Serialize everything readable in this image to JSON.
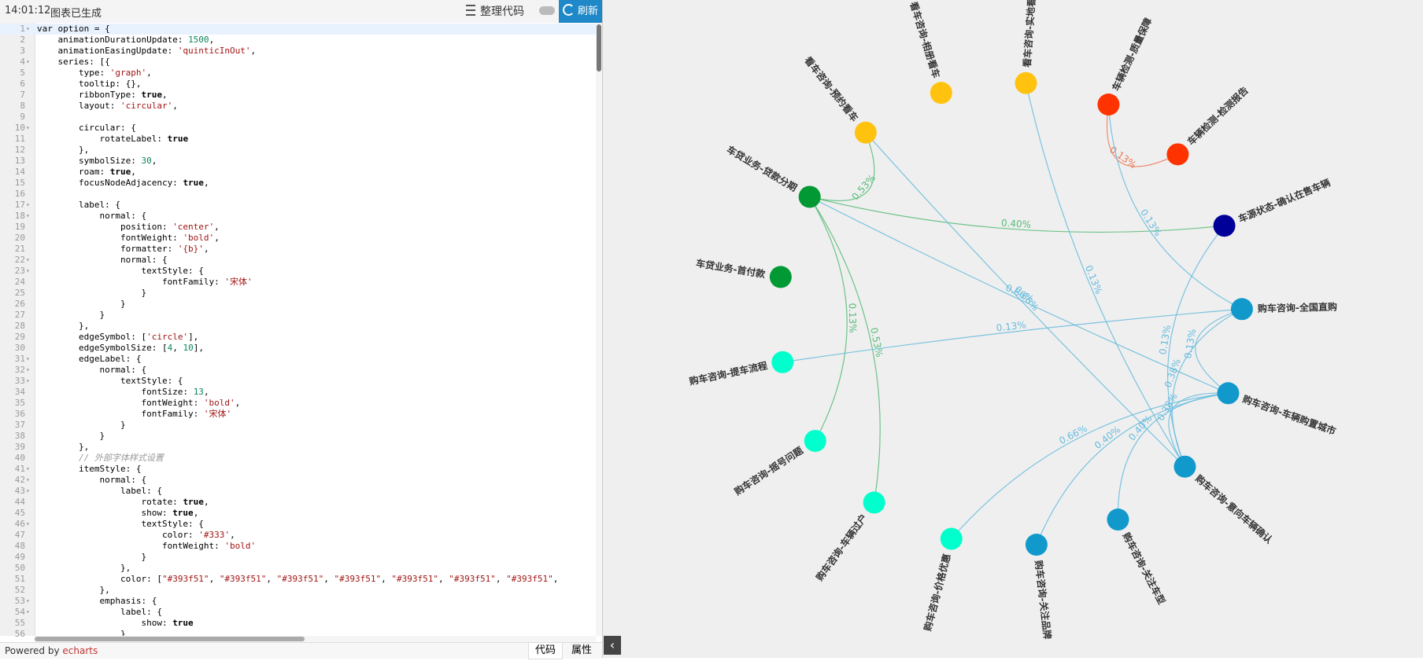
{
  "toolbar": {
    "time": "14:01:12",
    "status": "图表已生成",
    "format_label": "整理代码",
    "refresh_label": "刷新"
  },
  "footer": {
    "powered_prefix": "Powered by ",
    "powered_link": "echarts",
    "tab_code": "代码",
    "tab_props": "属性"
  },
  "code_lines": [
    "var option = {",
    "    animationDurationUpdate: 1500,",
    "    animationEasingUpdate: 'quinticInOut',",
    "    series: [{",
    "        type: 'graph',",
    "        tooltip: {},",
    "        ribbonType: true,",
    "        layout: 'circular',",
    "",
    "        circular: {",
    "            rotateLabel: true",
    "        },",
    "        symbolSize: 30,",
    "        roam: true,",
    "        focusNodeAdjacency: true,",
    "",
    "        label: {",
    "            normal: {",
    "                position: 'center',",
    "                fontWeight: 'bold',",
    "                formatter: '{b}',",
    "                normal: {",
    "                    textStyle: {",
    "                        fontFamily: '宋体'",
    "                    }",
    "                }",
    "            }",
    "        },",
    "        edgeSymbol: ['circle'],",
    "        edgeSymbolSize: [4, 10],",
    "        edgeLabel: {",
    "            normal: {",
    "                textStyle: {",
    "                    fontSize: 13,",
    "                    fontWeight: 'bold',",
    "                    fontFamily: '宋体'",
    "                }",
    "            }",
    "        },",
    "        // 外部字体样式设置",
    "        itemStyle: {",
    "            normal: {",
    "                label: {",
    "                    rotate: true,",
    "                    show: true,",
    "                    textStyle: {",
    "                        color: '#333',",
    "                        fontWeight: 'bold'",
    "                    }",
    "                },",
    "                color: [\"#393f51\", \"#393f51\", \"#393f51\", \"#393f51\", \"#393f51\", \"#393f51\", \"#393f51\", ",
    "            },",
    "            emphasis: {",
    "                label: {",
    "                    show: true",
    "                }"
  ],
  "fold_lines": [
    1,
    4,
    10,
    17,
    18,
    22,
    23,
    31,
    32,
    33,
    41,
    42,
    43,
    46,
    53,
    54
  ],
  "graph": {
    "nodes": [
      {
        "name": "看车咨询-相册看车",
        "color": "#ffc20e"
      },
      {
        "name": "看车咨询-实地看车",
        "color": "#ffc20e"
      },
      {
        "name": "车辆检测-质量保障",
        "color": "#ff3300"
      },
      {
        "name": "车辆检测-检测报告",
        "color": "#ff3300"
      },
      {
        "name": "车源状态-确认在售车辆",
        "color": "#000099"
      },
      {
        "name": "购车咨询-全国直购",
        "color": "#1199cc"
      },
      {
        "name": "购车咨询-车辆购置城市",
        "color": "#1199cc"
      },
      {
        "name": "购车咨询-意向车辆确认",
        "color": "#1199cc"
      },
      {
        "name": "购车咨询-关注车型",
        "color": "#1199cc"
      },
      {
        "name": "购车咨询-关注品牌",
        "color": "#1199cc"
      },
      {
        "name": "购车咨询-价格优惠",
        "color": "#00ffcc"
      },
      {
        "name": "购车咨询-车辆过户",
        "color": "#00ffcc"
      },
      {
        "name": "购车咨询-摇号问题",
        "color": "#00ffcc"
      },
      {
        "name": "购车咨询-提车流程",
        "color": "#00ffcc"
      },
      {
        "name": "车贷业务-首付款",
        "color": "#009933"
      },
      {
        "name": "车贷业务-贷款分期",
        "color": "#009933"
      },
      {
        "name": "看车咨询-预约看车",
        "color": "#ffc20e"
      }
    ],
    "edges": [
      {
        "source": 2,
        "target": 3,
        "label": "0.13%",
        "color": "#ee7755"
      },
      {
        "source": 16,
        "target": 15,
        "label": "0.53%",
        "color": "#55bb77"
      },
      {
        "source": 15,
        "target": 4,
        "label": "0.40%",
        "color": "#55bb77"
      },
      {
        "source": 15,
        "target": 12,
        "label": "0.13%",
        "color": "#55bb77"
      },
      {
        "source": 15,
        "target": 11,
        "label": "0.53%",
        "color": "#55bb77"
      },
      {
        "source": 15,
        "target": 6,
        "label": "0.66%",
        "color": "#66bbdd"
      },
      {
        "source": 16,
        "target": 7,
        "label": "0.66%",
        "color": "#66bbdd"
      },
      {
        "source": 1,
        "target": 7,
        "label": "0.13%",
        "color": "#66bbdd"
      },
      {
        "source": 2,
        "target": 5,
        "label": "0.13%",
        "color": "#66bbdd"
      },
      {
        "source": 13,
        "target": 5,
        "label": "0.13%",
        "color": "#66bbdd"
      },
      {
        "source": 4,
        "target": 7,
        "label": "0.13%",
        "color": "#66bbdd"
      },
      {
        "source": 10,
        "target": 6,
        "label": "0.66%",
        "color": "#66bbdd"
      },
      {
        "source": 9,
        "target": 6,
        "label": "0.40%",
        "color": "#66bbdd"
      },
      {
        "source": 8,
        "target": 6,
        "label": "0.40%",
        "color": "#66bbdd"
      },
      {
        "source": 5,
        "target": 7,
        "label": "0.38%",
        "color": "#66bbdd"
      },
      {
        "source": 6,
        "target": 5,
        "label": "0.13%",
        "color": "#66bbdd"
      },
      {
        "source": 7,
        "target": 6,
        "label": "0.38%",
        "color": "#66bbdd"
      }
    ]
  }
}
